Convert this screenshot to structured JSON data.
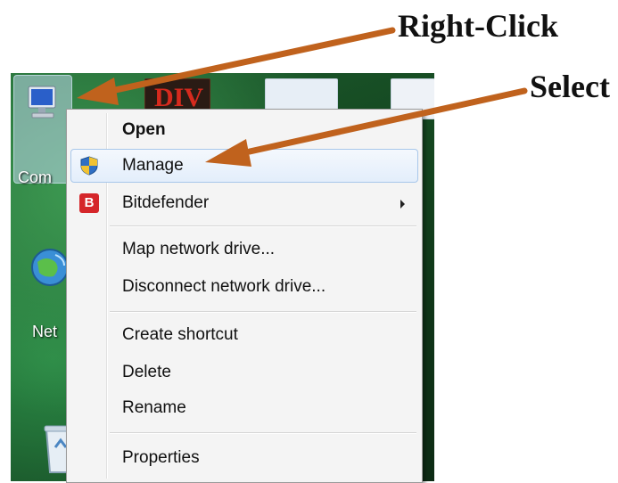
{
  "callouts": {
    "right_click": "Right-Click",
    "select": "Select"
  },
  "desktop": {
    "computer_icon_label": "Com",
    "network_icon_label": "Net",
    "background_icon_text": "DIV"
  },
  "context_menu": {
    "items": [
      {
        "label": "Open",
        "bold": true
      },
      {
        "label": "Manage",
        "icon": "uac-shield-icon",
        "highlighted": true
      },
      {
        "label": "Bitdefender",
        "icon": "bitdefender-icon",
        "submenu": true,
        "icon_text": "B"
      },
      {
        "label": "Map network drive..."
      },
      {
        "label": "Disconnect network drive..."
      },
      {
        "label": "Create shortcut"
      },
      {
        "label": "Delete"
      },
      {
        "label": "Rename"
      },
      {
        "label": "Properties"
      }
    ]
  },
  "colors": {
    "arrow": "#c0621d",
    "highlight_border": "#a8c7ea",
    "bitdefender": "#d5262a"
  }
}
